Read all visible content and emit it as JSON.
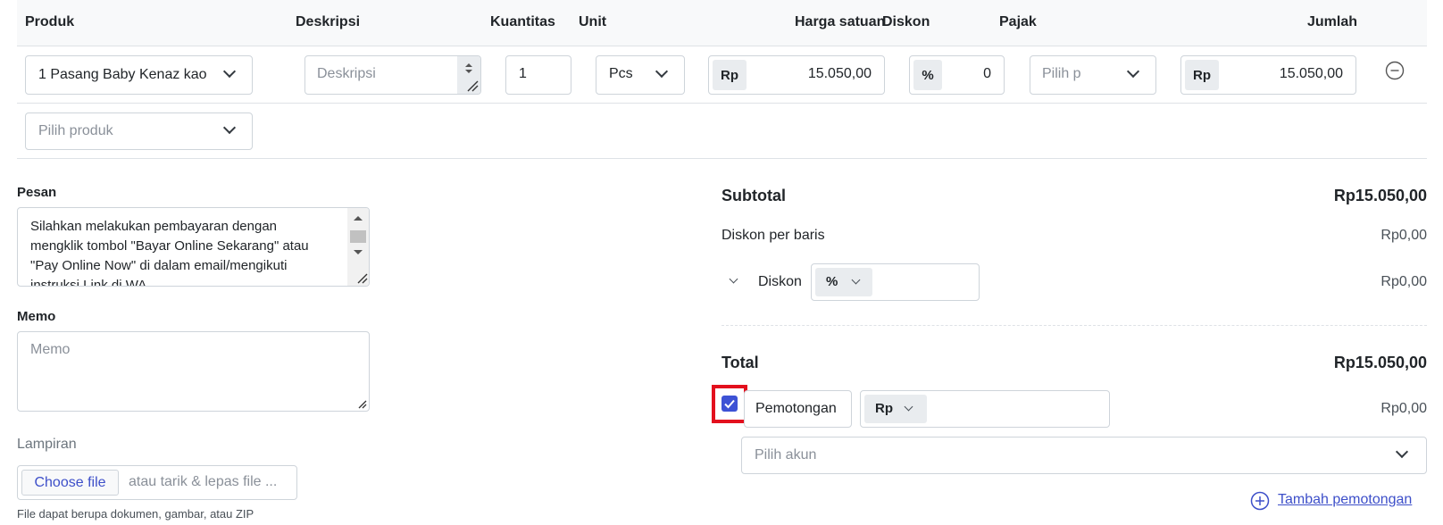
{
  "table": {
    "headers": {
      "produk": "Produk",
      "deskripsi": "Deskripsi",
      "kuantitas": "Kuantitas",
      "unit": "Unit",
      "harga": "Harga satuan",
      "diskon": "Diskon",
      "pajak": "Pajak",
      "jumlah": "Jumlah"
    },
    "row": {
      "product": "1 Pasang Baby Kenaz kao",
      "description_placeholder": "Deskripsi",
      "quantity": "1",
      "unit": "Pcs",
      "price_prefix": "Rp",
      "price": "15.050,00",
      "discount_prefix": "%",
      "discount": "0",
      "tax_placeholder": "Pilih p",
      "total_prefix": "Rp",
      "total": "15.050,00"
    },
    "new_product_placeholder": "Pilih produk"
  },
  "pesan": {
    "label": "Pesan",
    "text": "Silahkan melakukan pembayaran dengan mengklik tombol \"Bayar Online Sekarang\" atau \"Pay Online Now\" di dalam email/mengikuti instruksi Link di WA"
  },
  "memo": {
    "label": "Memo",
    "placeholder": "Memo"
  },
  "lampiran": {
    "label": "Lampiran",
    "button": "Choose file",
    "dropzone": "atau tarik & lepas file ...",
    "hint": "File dapat berupa dokumen, gambar, atau ZIP"
  },
  "summary": {
    "subtotal_label": "Subtotal",
    "subtotal_value": "Rp15.050,00",
    "line_discount_label": "Diskon per baris",
    "line_discount_value": "Rp0,00",
    "discount_label": "Diskon",
    "discount_type": "%",
    "discount_value": "Rp0,00",
    "total_label": "Total",
    "total_value": "Rp15.050,00",
    "deduction_label": "Pemotongan",
    "deduction_type": "Rp",
    "deduction_value": "Rp0,00",
    "account_placeholder": "Pilih akun",
    "add_deduction": "Tambah pemotongan"
  },
  "colors": {
    "accent": "#3d4fc9",
    "checkbox": "#3d52d5",
    "highlight": "#e3101d"
  }
}
